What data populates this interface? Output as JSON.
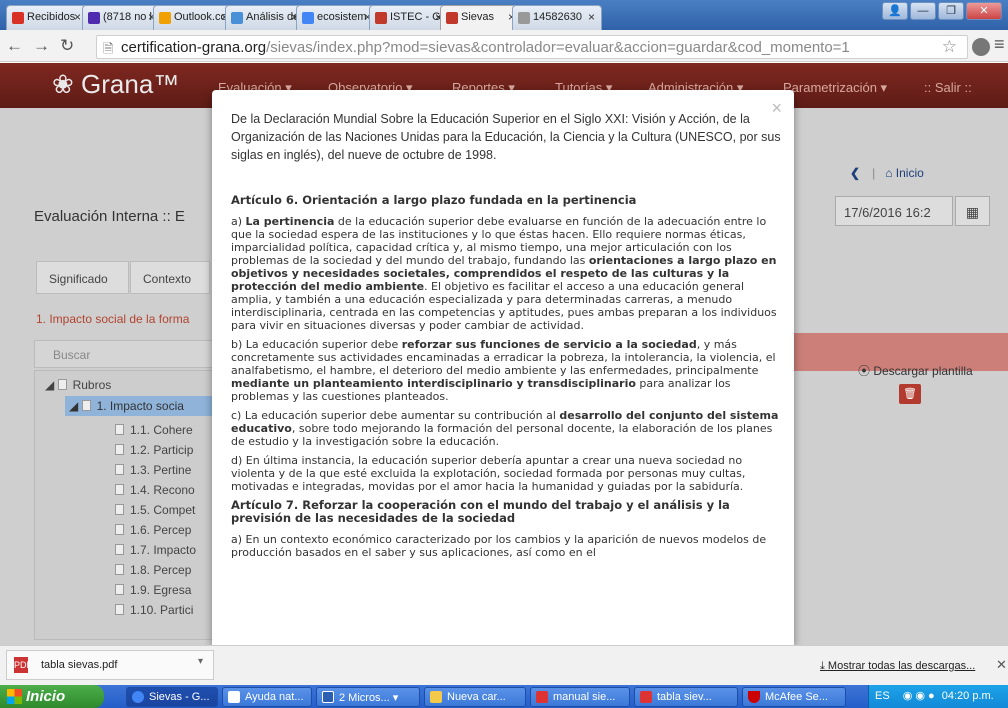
{
  "browser": {
    "tabs": [
      {
        "label": "Recibidos",
        "color": "#d93025"
      },
      {
        "label": "(8718 no l",
        "color": "#4f2bb0"
      },
      {
        "label": "Outlook.co",
        "color": "#f0a000"
      },
      {
        "label": "Análisis de",
        "color": "#4a90d9"
      },
      {
        "label": "ecosistem",
        "color": "#4285f4"
      },
      {
        "label": "ISTEC - G",
        "color": "#c0392b"
      },
      {
        "label": "Sievas",
        "color": "#c0392b"
      },
      {
        "label": "14582630",
        "color": "#999999"
      }
    ],
    "url_host": "certification-grana.org",
    "url_path": "/sievas/index.php?mod=sievas&controlador=evaluar&accion=guardar&cod_momento=1"
  },
  "app": {
    "brand": "Grana™",
    "nav": [
      "Evaluación ▾",
      "Observatorio ▾",
      "Reportes ▾",
      "Tutorías ▾",
      "Administración ▾",
      "Parametrización ▾",
      ":: Salir ::"
    ],
    "home": "Inicio",
    "title": "Evaluación Interna :: E",
    "date": "17/6/2016 16:2",
    "tabs": [
      "Significado",
      "Contexto"
    ],
    "subhead": "1. Impacto social de la forma",
    "search_placeholder": "Buscar",
    "download_template": "Descargar plantilla",
    "tree": [
      "Rubros",
      "1. Impacto socia",
      "1.1. Cohere",
      "1.2. Particip",
      "1.3. Pertine",
      "1.4. Recono",
      "1.5. Compet",
      "1.6. Percep",
      "1.7. Impacto",
      "1.8. Percep",
      "1.9. Egresa",
      "1.10. Partici"
    ]
  },
  "modal": {
    "intro": "De la Declaración Mundial Sobre la Educación Superior en el Siglo XXI: Visión y Acción, de la Organización de las Naciones Unidas para la Educación, la Ciencia y la Cultura (UNESCO, por sus siglas en inglés), del nueve de octubre de 1998.",
    "h6": "Artículo 6. Orientación a largo plazo fundada en la pertinencia",
    "a_b1": "La pertinencia",
    "a_t1": " de la educación superior debe evaluarse en función de la adecuación entre lo que la sociedad espera de las instituciones y lo que éstas hacen. Ello requiere normas éticas, imparcialidad política, capacidad crítica y, al mismo tiempo, una mejor articulación con los problemas de la sociedad y del mundo del trabajo, fundando las ",
    "a_b2": "orientaciones a largo plazo en objetivos y necesidades societales, comprendidos el respeto de las culturas y la protección del medio ambiente",
    "a_t2": ". El objetivo es facilitar el acceso a una educación general amplia, y también a una educación especializada y para determinadas carreras, a menudo interdisciplinaria, centrada en las competencias y aptitudes, pues ambas preparan a los individuos para vivir en situaciones diversas y poder cambiar de actividad.",
    "b_t1": "b) La educación superior debe ",
    "b_b1": "reforzar sus funciones de servicio a la sociedad",
    "b_t2": ", y más concretamente sus actividades encaminadas a erradicar la pobreza, la intolerancia, la violencia, el analfabetismo, el hambre, el deterioro del medio ambiente y las enfermedades, principalmente ",
    "b_b2": "mediante un planteamiento interdisciplinario y transdisciplinario",
    "b_t3": " para analizar los problemas y las cuestiones planteados.",
    "c_t1": "c) La educación superior debe aumentar su contribución al ",
    "c_b1": "desarrollo del conjunto del sistema educativo",
    "c_t2": ", sobre todo mejorando la formación del personal docente, la elaboración de los planes de estudio y la investigación sobre la educación.",
    "d": "d) En última instancia, la educación superior debería apuntar a crear una nueva sociedad no violenta y de la que esté excluida la explotación, sociedad formada por personas muy cultas, motivadas e integradas, movidas por el amor hacia la humanidad y guiadas por la sabiduría.",
    "h7": "Artículo 7. Reforzar la cooperación con el mundo del trabajo y el análisis y la previsión de las necesidades de la sociedad",
    "a7": "a) En un contexto económico caracterizado por los cambios y la aparición de nuevos modelos de producción basados en el saber y sus aplicaciones, así como en el"
  },
  "downloads": {
    "file": "tabla sievas.pdf",
    "show_all": "Mostrar todas las descargas..."
  },
  "taskbar": {
    "start": "Inicio",
    "items": [
      "Sievas - G...",
      "Ayuda nat...",
      "2 Micros...",
      "Nueva car...",
      "manual sie...",
      "tabla siev...",
      "McAfee Se..."
    ],
    "lang": "ES",
    "time": "04:20 p.m."
  }
}
